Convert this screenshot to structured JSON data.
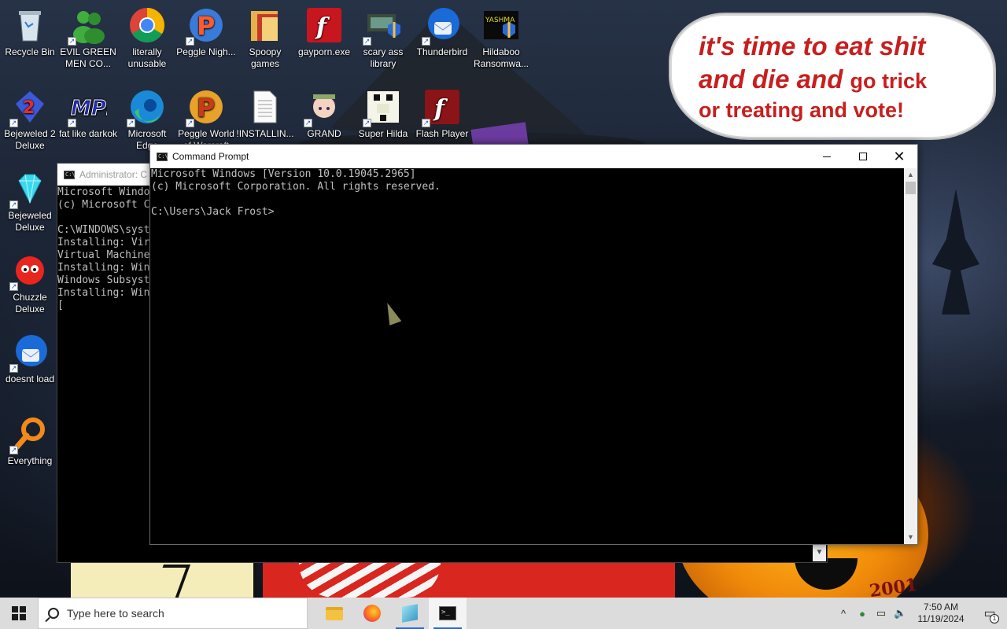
{
  "wallpaper": {
    "speech_bubble": {
      "line1": "it's time to eat shit",
      "line2_italic": "and die and",
      "line2_plain": "go trick",
      "line3": "or treating and vote!"
    }
  },
  "desktop_icons": [
    {
      "label": "Recycle Bin",
      "icon": "recycle-bin-icon"
    },
    {
      "label": "EVIL GREEN MEN CO...",
      "icon": "green-men-icon"
    },
    {
      "label": "literally unusable",
      "icon": "chrome-icon"
    },
    {
      "label": "Peggle Nigh...",
      "icon": "peggle-icon"
    },
    {
      "label": "Spoopy games",
      "icon": "folder-icon"
    },
    {
      "label": "gayporn.exe",
      "icon": "flash-icon"
    },
    {
      "label": "scary ass library",
      "icon": "library-icon"
    },
    {
      "label": "Thunderbird",
      "icon": "thunderbird-icon"
    },
    {
      "label": "Hildaboo Ransomwa...",
      "icon": "yashma-icon"
    },
    {
      "label": "Bejeweled 2 Deluxe",
      "icon": "bejeweled-2-icon"
    },
    {
      "label": "fat like darkok",
      "icon": "mpl-icon"
    },
    {
      "label": "Microsoft Edge",
      "icon": "edge-icon"
    },
    {
      "label": "Peggle World of Warcraft",
      "icon": "peggle-wow-icon"
    },
    {
      "label": "!INSTALLIN...",
      "icon": "text-document-icon"
    },
    {
      "label": "GRAND",
      "icon": "anime-girl-icon"
    },
    {
      "label": "Super Hilda",
      "icon": "pixel-art-icon"
    },
    {
      "label": "Flash Player",
      "icon": "flash-player-icon"
    },
    {
      "label": "Bejeweled Deluxe",
      "icon": "diamond-icon"
    },
    {
      "label": "Chuzzle Deluxe",
      "icon": "chuzzle-icon"
    },
    {
      "label": "doesnt load",
      "icon": "thunderbird-icon"
    },
    {
      "label": "Everything",
      "icon": "everything-search-icon"
    }
  ],
  "admin_window": {
    "title": "Administrator: C",
    "lines": [
      "Microsoft Windo",
      "(c) Microsoft C",
      "",
      "C:\\WINDOWS\\syst",
      "Installing: Vir",
      "Virtual Machine",
      "Installing: Win",
      "Windows Subsyst",
      "Installing: Win",
      "["
    ]
  },
  "cmd_window": {
    "title": "Command Prompt",
    "lines": [
      "Microsoft Windows [Version 10.0.19045.2965]",
      "(c) Microsoft Corporation. All rights reserved.",
      "",
      "C:\\Users\\Jack Frost>"
    ],
    "controls": {
      "minimize": "minimize",
      "maximize": "maximize",
      "close": "close"
    }
  },
  "taskbar": {
    "search_placeholder": "Type here to search",
    "apps": [
      "File Explorer",
      "Firefox",
      "App",
      "Command Prompt"
    ],
    "clock_time": "7:50 AM",
    "clock_date": "11/19/2024",
    "notification_count": "1"
  },
  "colors": {
    "bubble_text": "#c81e1e",
    "terminal_text": "#c0c0c0",
    "taskbar": "#dcdcdc"
  }
}
